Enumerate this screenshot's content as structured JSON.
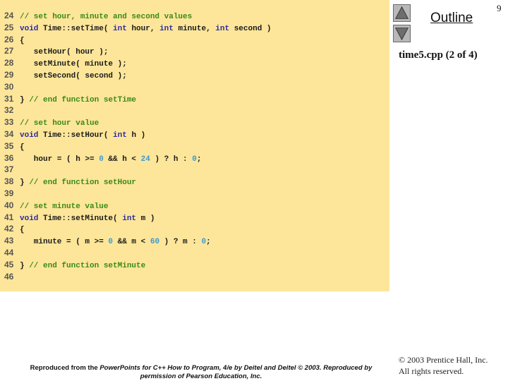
{
  "slide": {
    "page_number": "9",
    "outline_title": "Outline",
    "file_label": "time5.cpp (2 of 4)",
    "nav": {
      "up_icon": "triangle-up-icon",
      "down_icon": "triangle-down-icon"
    }
  },
  "code": {
    "lines": [
      {
        "n": "24",
        "tokens": [
          {
            "t": "cm",
            "v": "// set hour, minute and second values"
          }
        ]
      },
      {
        "n": "25",
        "tokens": [
          {
            "t": "kw",
            "v": "void"
          },
          {
            "t": "",
            "v": " Time::setTime( "
          },
          {
            "t": "kw",
            "v": "int"
          },
          {
            "t": "",
            "v": " hour, "
          },
          {
            "t": "kw",
            "v": "int"
          },
          {
            "t": "",
            "v": " minute, "
          },
          {
            "t": "kw",
            "v": "int"
          },
          {
            "t": "",
            "v": " second )"
          }
        ]
      },
      {
        "n": "26",
        "tokens": [
          {
            "t": "",
            "v": "{"
          }
        ]
      },
      {
        "n": "27",
        "tokens": [
          {
            "t": "",
            "v": "   setHour( hour );"
          }
        ]
      },
      {
        "n": "28",
        "tokens": [
          {
            "t": "",
            "v": "   setMinute( minute );"
          }
        ]
      },
      {
        "n": "29",
        "tokens": [
          {
            "t": "",
            "v": "   setSecond( second );"
          }
        ]
      },
      {
        "n": "30",
        "tokens": []
      },
      {
        "n": "31",
        "tokens": [
          {
            "t": "",
            "v": "} "
          },
          {
            "t": "cm",
            "v": "// end function setTime"
          }
        ]
      },
      {
        "n": "32",
        "tokens": []
      },
      {
        "n": "33",
        "tokens": [
          {
            "t": "cm",
            "v": "// set hour value"
          }
        ]
      },
      {
        "n": "34",
        "tokens": [
          {
            "t": "kw",
            "v": "void"
          },
          {
            "t": "",
            "v": " Time::setHour( "
          },
          {
            "t": "kw",
            "v": "int"
          },
          {
            "t": "",
            "v": " h )"
          }
        ]
      },
      {
        "n": "35",
        "tokens": [
          {
            "t": "",
            "v": "{"
          }
        ]
      },
      {
        "n": "36",
        "tokens": [
          {
            "t": "",
            "v": "   hour = ( h >= "
          },
          {
            "t": "num",
            "v": "0"
          },
          {
            "t": "",
            "v": " && h < "
          },
          {
            "t": "num",
            "v": "24"
          },
          {
            "t": "",
            "v": " ) ? h : "
          },
          {
            "t": "num",
            "v": "0"
          },
          {
            "t": "",
            "v": ";"
          }
        ]
      },
      {
        "n": "37",
        "tokens": []
      },
      {
        "n": "38",
        "tokens": [
          {
            "t": "",
            "v": "} "
          },
          {
            "t": "cm",
            "v": "// end function setHour"
          }
        ]
      },
      {
        "n": "39",
        "tokens": []
      },
      {
        "n": "40",
        "tokens": [
          {
            "t": "cm",
            "v": "// set minute value"
          }
        ]
      },
      {
        "n": "41",
        "tokens": [
          {
            "t": "kw",
            "v": "void"
          },
          {
            "t": "",
            "v": " Time::setMinute( "
          },
          {
            "t": "kw",
            "v": "int"
          },
          {
            "t": "",
            "v": " m )"
          }
        ]
      },
      {
        "n": "42",
        "tokens": [
          {
            "t": "",
            "v": "{"
          }
        ]
      },
      {
        "n": "43",
        "tokens": [
          {
            "t": "",
            "v": "   minute = ( m >= "
          },
          {
            "t": "num",
            "v": "0"
          },
          {
            "t": "",
            "v": " && m < "
          },
          {
            "t": "num",
            "v": "60"
          },
          {
            "t": "",
            "v": " ) ? m : "
          },
          {
            "t": "num",
            "v": "0"
          },
          {
            "t": "",
            "v": ";"
          }
        ]
      },
      {
        "n": "44",
        "tokens": []
      },
      {
        "n": "45",
        "tokens": [
          {
            "t": "",
            "v": "} "
          },
          {
            "t": "cm",
            "v": "// end function setMinute"
          }
        ]
      },
      {
        "n": "46",
        "tokens": []
      }
    ]
  },
  "footer": {
    "line1_prefix": "Reproduced from the ",
    "line1_italic": "PowerPoints for C++ How to Program, 4/e by Deitel and Deitel © 2003. Reproduced by",
    "line2_italic": "permission of Pearson Education, Inc."
  },
  "copyright": {
    "line1": "© 2003 Prentice Hall, Inc.",
    "line2": "All rights reserved."
  },
  "colors": {
    "code_background": "#fde69a",
    "keyword": "#2a2aa0",
    "comment": "#3a8a14",
    "number": "#3a9ad0"
  }
}
